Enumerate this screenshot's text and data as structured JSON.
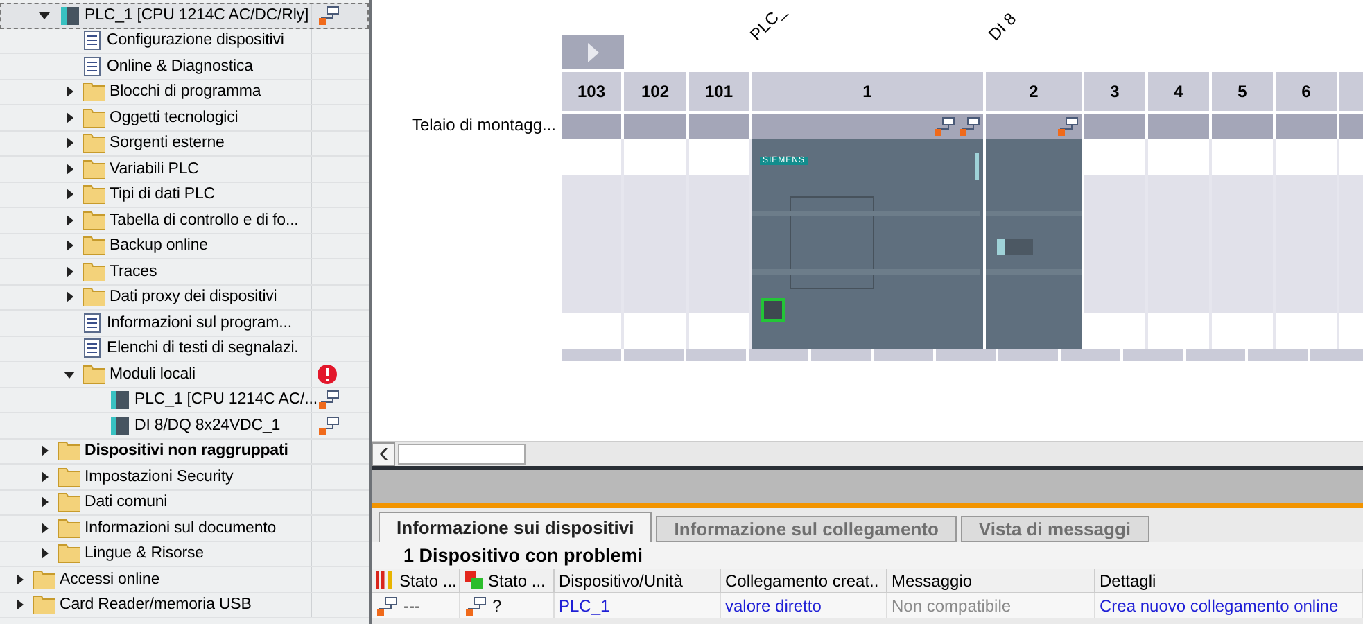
{
  "tree": {
    "project_children": [
      {
        "label": "PLC_1 [CPU 1214C AC/DC/Rly]",
        "kind": "device",
        "expanded": true,
        "selected": true,
        "network_icon": true,
        "children": [
          {
            "label": "Configurazione dispositivi",
            "kind": "item"
          },
          {
            "label": "Online & Diagnostica",
            "kind": "item"
          },
          {
            "label": "Blocchi di programma",
            "kind": "folder",
            "expanded": false
          },
          {
            "label": "Oggetti tecnologici",
            "kind": "folder",
            "expanded": false
          },
          {
            "label": "Sorgenti esterne",
            "kind": "folder",
            "expanded": false
          },
          {
            "label": "Variabili PLC",
            "kind": "folder",
            "expanded": false
          },
          {
            "label": "Tipi di dati PLC",
            "kind": "folder",
            "expanded": false
          },
          {
            "label": "Tabella di controllo e di fo...",
            "kind": "folder",
            "expanded": false
          },
          {
            "label": "Backup online",
            "kind": "folder",
            "expanded": false
          },
          {
            "label": "Traces",
            "kind": "folder",
            "expanded": false
          },
          {
            "label": "Dati proxy dei dispositivi",
            "kind": "folder",
            "expanded": false
          },
          {
            "label": "Informazioni sul program...",
            "kind": "item"
          },
          {
            "label": "Elenchi di testi di segnalazi.",
            "kind": "item"
          },
          {
            "label": "Moduli locali",
            "kind": "folder",
            "expanded": true,
            "error": true,
            "children": [
              {
                "label": "PLC_1 [CPU 1214C AC/...",
                "kind": "device",
                "network_icon": true
              },
              {
                "label": "DI 8/DQ 8x24VDC_1",
                "kind": "device",
                "network_icon": true
              }
            ]
          }
        ]
      },
      {
        "label": "Dispositivi non raggruppati",
        "kind": "folder",
        "expanded": false,
        "bold": true
      },
      {
        "label": "Impostazioni Security",
        "kind": "folder",
        "expanded": false
      },
      {
        "label": "Dati comuni",
        "kind": "folder",
        "expanded": false
      },
      {
        "label": "Informazioni sul documento",
        "kind": "folder",
        "expanded": false
      },
      {
        "label": "Lingue & Risorse",
        "kind": "folder",
        "expanded": false
      }
    ],
    "items": [
      {
        "label": "Accessi online",
        "kind": "folder",
        "expanded": false
      },
      {
        "label": "Card Reader/memoria USB",
        "kind": "folder",
        "expanded": false
      }
    ]
  },
  "device_view": {
    "rotated_labels": [
      "PLC_",
      "DI 8"
    ],
    "rack_label": "Telaio di montagg...",
    "module_brand": "SIEMENS",
    "slots": [
      {
        "label": "103",
        "kind": "empty"
      },
      {
        "label": "102",
        "kind": "empty"
      },
      {
        "label": "101",
        "kind": "empty"
      },
      {
        "label": "1",
        "kind": "cpu"
      },
      {
        "label": "2",
        "kind": "sm"
      },
      {
        "label": "3",
        "kind": "empty"
      },
      {
        "label": "4",
        "kind": "empty"
      },
      {
        "label": "5",
        "kind": "empty"
      },
      {
        "label": "6",
        "kind": "empty"
      }
    ]
  },
  "inspector": {
    "tabs": [
      {
        "label": "Informazione sui dispositivi",
        "selected": true
      },
      {
        "label": "Informazione sul collegamento",
        "selected": false
      },
      {
        "label": "Vista di messaggi",
        "selected": false
      }
    ],
    "heading": "1 Dispositivo con problemi",
    "columns": [
      "Stato ...",
      "Stato ...",
      "Dispositivo/Unità",
      "Collegamento creat..",
      "Messaggio",
      "Dettagli"
    ],
    "rows": [
      {
        "cells": [
          {
            "text": "---",
            "kind": "text"
          },
          {
            "text": "?",
            "kind": "text"
          },
          {
            "text": "PLC_1",
            "kind": "link"
          },
          {
            "text": "valore diretto",
            "kind": "link"
          },
          {
            "text": "Non compatibile",
            "kind": "muted"
          },
          {
            "text": "Crea nuovo collegamento online",
            "kind": "link"
          }
        ]
      }
    ]
  }
}
